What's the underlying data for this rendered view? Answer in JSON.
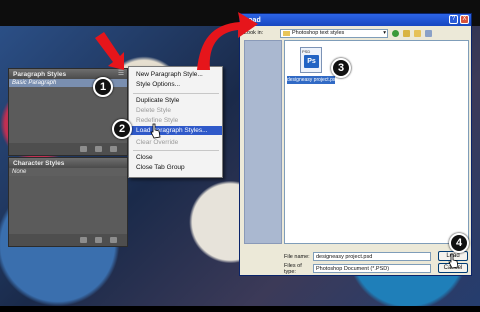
{
  "paragraph_panel": {
    "title": "Paragraph Styles",
    "selected_item": "Basic Paragraph"
  },
  "character_panel": {
    "title": "Character Styles",
    "selected_item": "None"
  },
  "menu": {
    "items": [
      {
        "label": "New Paragraph Style...",
        "state": "normal"
      },
      {
        "label": "Style Options...",
        "state": "normal"
      },
      {
        "label": "Duplicate Style",
        "state": "normal"
      },
      {
        "label": "Delete Style",
        "state": "disabled"
      },
      {
        "label": "Redefine Style",
        "state": "disabled"
      },
      {
        "label": "Load Paragraph Styles...",
        "state": "highlighted"
      },
      {
        "label": "Clear Override",
        "state": "disabled"
      },
      {
        "label": "Close",
        "state": "normal"
      },
      {
        "label": "Close Tab Group",
        "state": "normal"
      }
    ]
  },
  "dialog": {
    "title": "Load",
    "help_label": "?",
    "close_label": "X",
    "look_in_label": "Look in:",
    "look_in_value": "Photoshop text styles",
    "file": {
      "name": "designeasy project.psd",
      "icon_text": "Ps",
      "type_text": "PSD"
    },
    "file_name_label": "File name:",
    "file_name_value": "designeasy project.psd",
    "files_of_type_label": "Files of type:",
    "files_of_type_value": "Photoshop Document (*.PSD)",
    "load_button": "Load",
    "cancel_button": "Cancel"
  },
  "callouts": [
    "1",
    "2",
    "3",
    "4"
  ],
  "colors": {
    "highlight": "#2f59c9",
    "title_bar": "#1f55d6",
    "arrow": "#e6151b",
    "selection": "#316ac5"
  }
}
